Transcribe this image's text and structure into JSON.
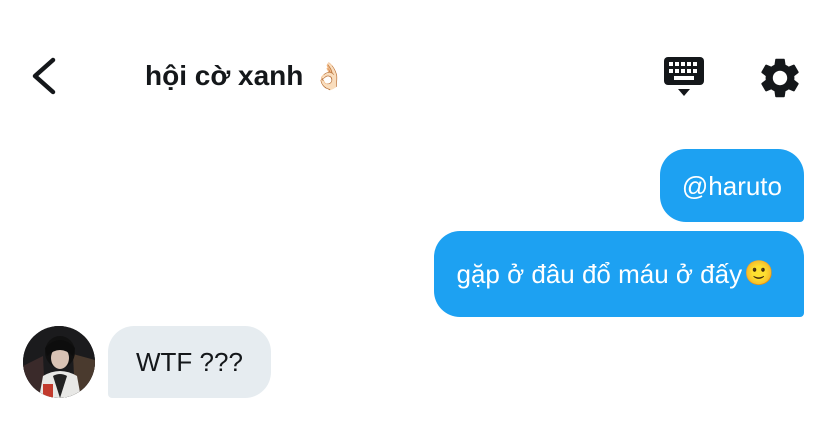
{
  "header": {
    "title": "hội cờ xanh",
    "title_emoji": "👌🏻",
    "back_icon": "chevron-left-icon",
    "keyboard_icon": "keyboard-icon",
    "settings_icon": "gear-icon"
  },
  "messages": {
    "outgoing": [
      {
        "text": "@haruto"
      },
      {
        "text": "gặp ở đâu đổ máu ở đấy",
        "emoji": "🙂"
      }
    ],
    "incoming": [
      {
        "text": "WTF ???",
        "avatar_icon": "user-avatar"
      }
    ]
  },
  "colors": {
    "accent": "#1da1f2",
    "incoming_bubble": "#e6ecf0",
    "text": "#14171a"
  }
}
